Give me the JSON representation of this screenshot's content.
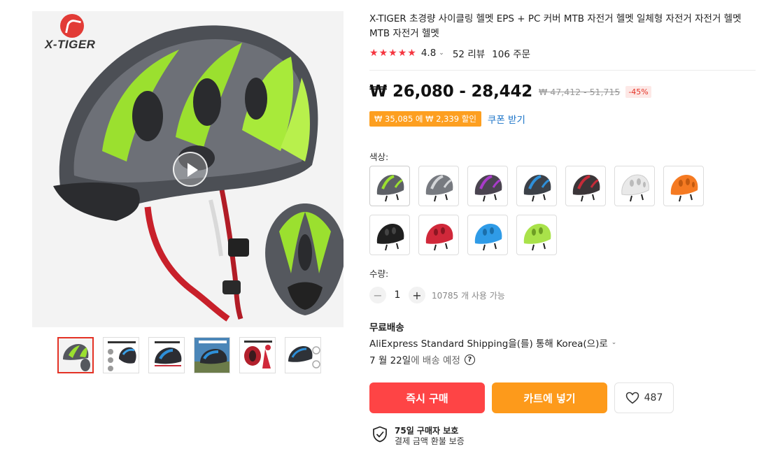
{
  "gallery": {
    "brand": "X-TIGER",
    "main_alt": "helmet-lime-gray",
    "thumbnails": [
      {
        "name": "lime-gray-helmet"
      },
      {
        "name": "helmet-detail-sheet"
      },
      {
        "name": "blue-helmet-feature"
      },
      {
        "name": "blue-helmet-scene"
      },
      {
        "name": "red-helmet-sheet"
      },
      {
        "name": "helmet-visor-detail"
      }
    ]
  },
  "product": {
    "title": "X-TIGER 초경량 사이클링 헬멧 EPS + PC 커버 MTB 자전거 헬멧 일체형 자전거 자전거 헬멧 MTB 자전거 헬멧",
    "rating": "4.8",
    "rating_caret": "⌄",
    "review_count": "52 리뷰",
    "order_count": "106 주문"
  },
  "price": {
    "current": "₩ 26,080 - 28,442",
    "original": "₩ 47,412 - 51,715",
    "discount": "-45%"
  },
  "coupon": {
    "tag": "₩ 35,085 에 ₩ 2,339 할인",
    "link": "쿠폰 받기"
  },
  "colors": {
    "label": "색상:",
    "swatches": [
      {
        "name": "lime-gray",
        "shell": "#5d6066",
        "accent": "#9be02f"
      },
      {
        "name": "silver-gray",
        "shell": "#777a80",
        "accent": "#d3d5d8"
      },
      {
        "name": "purple",
        "shell": "#4a4450",
        "accent": "#a83bc9"
      },
      {
        "name": "blue",
        "shell": "#3c4148",
        "accent": "#2e8fd8"
      },
      {
        "name": "red-black",
        "shell": "#3b3538",
        "accent": "#c52b38"
      },
      {
        "name": "white",
        "shell": "#e9e9e9",
        "accent": "#ffffff"
      },
      {
        "name": "orange",
        "shell": "#f57a22",
        "accent": "#ff9a3c"
      },
      {
        "name": "black",
        "shell": "#1f1f1f",
        "accent": "#333333"
      },
      {
        "name": "red",
        "shell": "#d0283a",
        "accent": "#e0465a"
      },
      {
        "name": "sky-blue",
        "shell": "#2f9be7",
        "accent": "#57b5f2"
      },
      {
        "name": "lime",
        "shell": "#a9e24a",
        "accent": "#c5f06e"
      }
    ]
  },
  "quantity": {
    "label": "수량:",
    "minus": "−",
    "value": "1",
    "plus": "+",
    "available": "10785 개 사용 가능"
  },
  "shipping": {
    "title": "무료배송",
    "method": "AliExpress Standard Shipping을(를) 통해 Korea(으)로",
    "method_caret": "⌄",
    "date": "7 월 22일",
    "date_suffix": "에 배송 예정",
    "help": "?"
  },
  "actions": {
    "buy_now": "즉시 구매",
    "add_to_cart": "카트에 넣기",
    "wishlist_count": "487"
  },
  "protection": {
    "title": "75일 구매자 보호",
    "subtitle": "결제 금액 환불 보증"
  },
  "colors_theme": {
    "accent_red": "#fe4445",
    "accent_orange": "#fd9a1b",
    "star": "#f53640",
    "link": "#1a73c8"
  }
}
